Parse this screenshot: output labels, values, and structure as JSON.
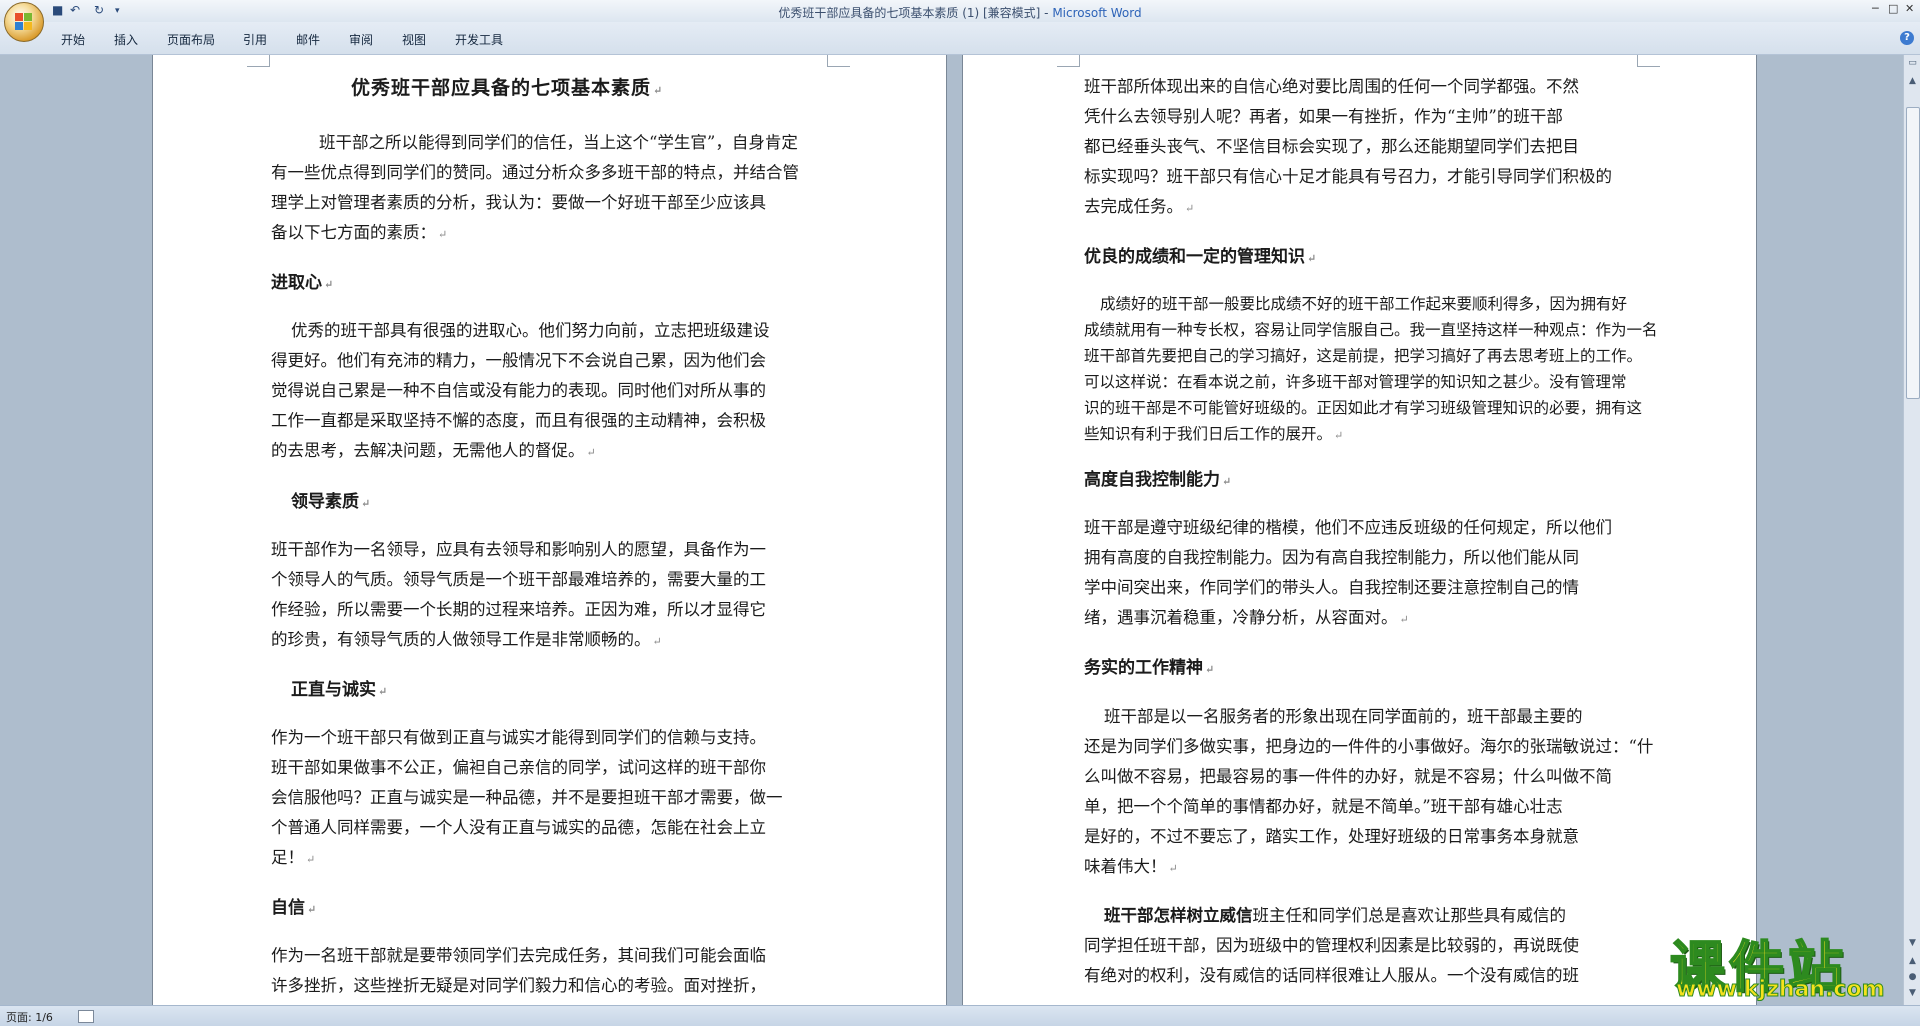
{
  "window": {
    "title_doc": "优秀班干部应具备的七项基本素质 (1) [兼容模式] - ",
    "title_app": "Microsoft Word",
    "quick_access": [
      "save-icon",
      "undo-icon",
      "redo-icon",
      "customize-icon"
    ],
    "controls": [
      "minimize-icon",
      "maximize-icon",
      "close-icon"
    ]
  },
  "ribbon": {
    "tabs": [
      "开始",
      "插入",
      "页面布局",
      "引用",
      "邮件",
      "审阅",
      "视图",
      "开发工具"
    ]
  },
  "page_left": {
    "title": "优秀班干部应具备的七项基本素质",
    "intro": [
      "班干部之所以能得到同学们的信任，当上这个“学生官”，自身肯定",
      "有一些优点得到同学们的赞同。通过分析众多多班干部的特点，并结合管",
      "理学上对管理者素质的分析，我认为：要做一个好班干部至少应该具",
      "备以下七方面的素质："
    ],
    "h_jinqu": "进取心",
    "jinqu": [
      "优秀的班干部具有很强的进取心。他们努力向前，立志把班级建设",
      "得更好。他们有充沛的精力，一般情况下不会说自己累，因为他们会",
      "觉得说自己累是一种不自信或没有能力的表现。同时他们对所从事的",
      "工作一直都是采取坚持不懈的态度，而且有很强的主动精神，会积极",
      "的去思考，去解决问题，无需他人的督促。"
    ],
    "h_lingdao": "领导素质",
    "lingdao": [
      "班干部作为一名领导，应具有去领导和影响别人的愿望，具备作为一",
      "个领导人的气质。领导气质是一个班干部最难培养的，需要大量的工",
      "作经验，所以需要一个长期的过程来培养。正因为难，所以才显得它",
      "的珍贵，有领导气质的人做领导工作是非常顺畅的。"
    ],
    "h_zhengzhi": "正直与诚实",
    "zhengzhi": [
      "作为一个班干部只有做到正直与诚实才能得到同学们的信赖与支持。",
      "班干部如果做事不公正，偏袒自己亲信的同学，试问这样的班干部你",
      "会信服他吗？正直与诚实是一种品德，并不是要担班干部才需要，做一",
      "个普通人同样需要，一个人没有正直与诚实的品德，怎能在社会上立",
      "足！"
    ],
    "h_zixin": "自信",
    "zixin": [
      "作为一名班干部就是要带领同学们去完成任务，其间我们可能会面临",
      "许多挫折，这些挫折无疑是对同学们毅力和信心的考验。面对挫折，"
    ]
  },
  "page_right": {
    "cont": [
      "班干部所体现出来的自信心绝对要比周围的任何一个同学都强。不然",
      "凭什么去领导别人呢？再者，如果一有挫折，作为“主帅”的班干部",
      "都已经垂头丧气、不坚信目标会实现了，那么还能期望同学们去把目",
      "标实现吗？班干部只有信心十足才能具有号召力，才能引导同学们积极的",
      "去完成任务。"
    ],
    "h_chengji": "优良的成绩和一定的管理知识",
    "chengji": [
      "成绩好的班干部一般要比成绩不好的班干部工作起来要顺利得多，因为拥有好",
      "成绩就用有一种专长权，容易让同学信服自己。我一直坚持这样一种观点：作为一名",
      "班干部首先要把自己的学习搞好，这是前提，把学习搞好了再去思考班上的工作。",
      "可以这样说：在看本说之前，许多班干部对管理学的知识知之甚少。没有管理常",
      "识的班干部是不可能管好班级的。正因如此才有学习班级管理知识的必要，拥有这",
      "些知识有利于我们日后工作的展开。"
    ],
    "h_kongzhi": "高度自我控制能力",
    "kongzhi": [
      "班干部是遵守班级纪律的楷模，他们不应违反班级的任何规定，所以他们",
      "拥有高度的自我控制能力。因为有高自我控制能力，所以他们能从同",
      "学中间突出来，作同学们的带头人。自我控制还要注意控制自己的情",
      "绪，遇事沉着稳重，冷静分析，从容面对。"
    ],
    "h_wushi": "务实的工作精神",
    "wushi": [
      "班干部是以一名服务者的形象出现在同学面前的，班干部最主要的",
      "还是为同学们多做实事，把身边的一件件的小事做好。海尔的张瑞敏说过：“什",
      "么叫做不容易，把最容易的事一件件的办好，就是不容易；什么叫做不简",
      "单，把一个个简单的事情都办好，就是不简单。”班干部有雄心壮志",
      "是好的，不过不要忘了，踏实工作，处理好班级的日常事务本身就意",
      "味着伟大！"
    ],
    "weixin_bold": "班干部怎样树立威信",
    "weixin": [
      "班主任和同学们总是喜欢让那些具有威信的",
      "同学担任班干部，因为班级中的管理权利因素是比较弱的，再说既使",
      "有绝对的权利，没有威信的话同样很难让人服从。一个没有威信的班"
    ]
  },
  "status": {
    "page_count": "页面: 1/6"
  },
  "watermark": {
    "main": "课件站",
    "url": "www.kjzhan.com"
  }
}
